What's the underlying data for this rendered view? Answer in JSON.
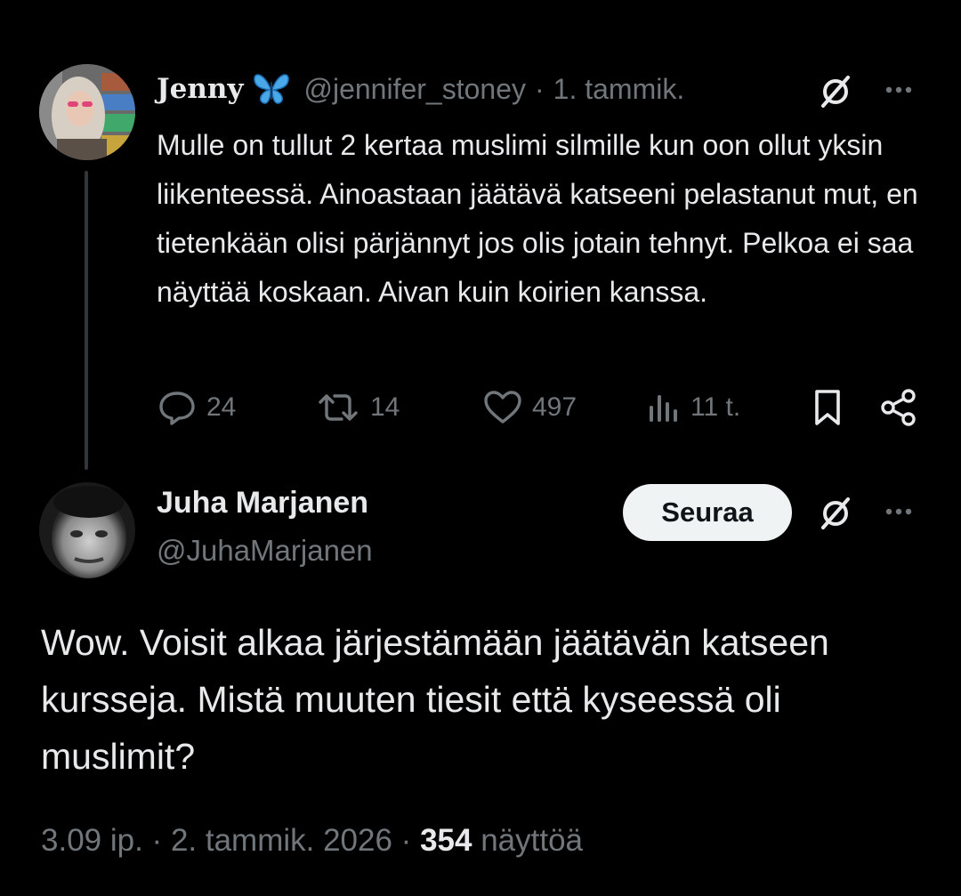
{
  "original_tweet": {
    "author_name": "Jenny",
    "handle": "@jennifer_stoney",
    "separator": "·",
    "date": "1. tammik.",
    "text": "Mulle on tullut 2 kertaa muslimi silmille kun oon ollut yksin liikenteessä. Ainoastaan jäätävä katseeni pelastanut mut, en tietenkään olisi pärjännyt jos olis jotain tehnyt. Pelkoa ei saa näyttää koskaan. Aivan kuin koirien kanssa.",
    "stats": {
      "replies": "24",
      "reposts": "14",
      "likes": "497",
      "views": "11 t."
    },
    "icons": [
      "butterfly-emoji-icon",
      "grok-icon",
      "more-icon",
      "reply-icon",
      "repost-icon",
      "like-icon",
      "views-icon",
      "bookmark-icon",
      "share-icon"
    ]
  },
  "reply_tweet": {
    "author_name": "Juha Marjanen",
    "handle": "@JuhaMarjanen",
    "follow_label": "Seuraa",
    "text": "Wow. Voisit alkaa järjestämään jäätävän katseen kursseja. Mistä muuten tiesit että kyseessä oli muslimit?",
    "time": "3.09 ip.",
    "separator": "·",
    "date": "2. tammik. 2026",
    "views_count": "354",
    "views_label": "näyttöä"
  },
  "colors": {
    "background": "#000000",
    "text_primary": "#e7e9ea",
    "text_secondary": "#71767b",
    "follow_button_bg": "#eff3f4",
    "thread_line": "#333639",
    "butterfly": "#4aa8e8"
  }
}
